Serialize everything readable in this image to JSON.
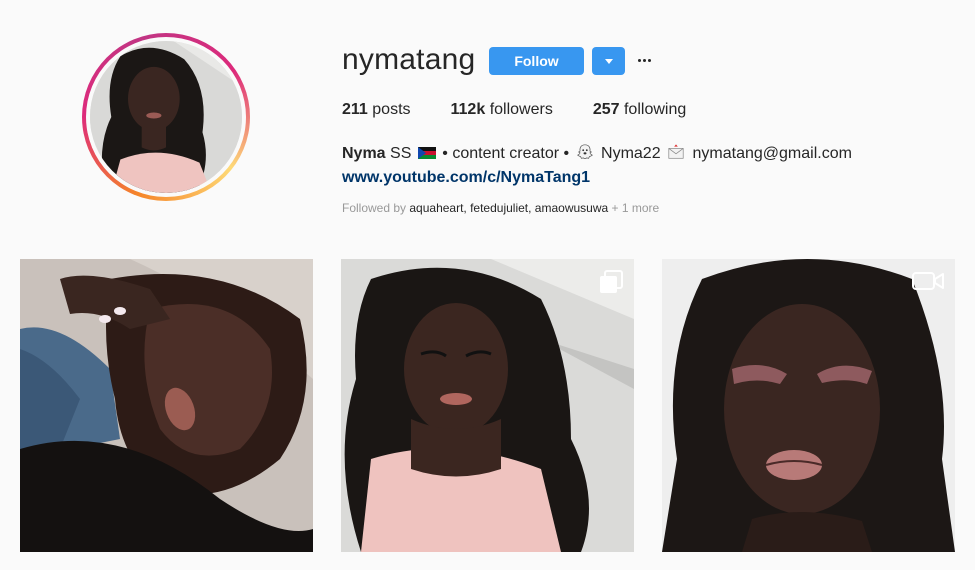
{
  "profile": {
    "username": "nymatang",
    "follow_label": "Follow",
    "stats": {
      "posts_count": "211",
      "posts_label": "posts",
      "followers_count": "112k",
      "followers_label": "followers",
      "following_count": "257",
      "following_label": "following"
    },
    "bio": {
      "name": "Nyma",
      "text_1": "SS",
      "text_2": "• content creator •",
      "text_3": "Nyma22",
      "text_4": "nymatang@gmail.com",
      "link": "www.youtube.com/c/NymaTang1"
    },
    "followed_by": {
      "prefix": "Followed by",
      "users": "aquaheart, fetedujuliet, amaowusuwa",
      "more": "+ 1 more"
    }
  },
  "icons": {
    "flag": "south-sudan-flag-icon",
    "snapchat": "snapchat-ghost-icon",
    "envelope": "envelope-icon",
    "carousel": "carousel-icon",
    "video": "video-camera-icon",
    "more": "more-options-icon",
    "dropdown": "chevron-down-icon"
  },
  "colors": {
    "follow_button": "#3897f0",
    "link": "#003569",
    "background": "#fafafa"
  },
  "posts": [
    {
      "type": "image"
    },
    {
      "type": "carousel"
    },
    {
      "type": "video"
    }
  ]
}
